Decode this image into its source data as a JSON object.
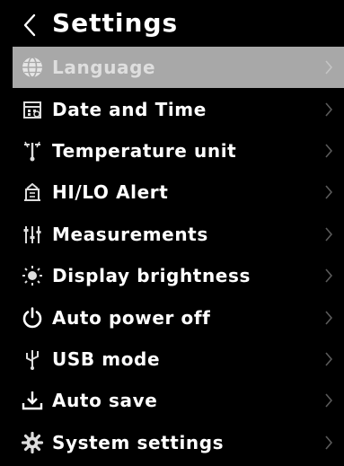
{
  "header": {
    "back_icon": "chevron-left-icon",
    "title": "Settings"
  },
  "menu": {
    "items": [
      {
        "label": "Language",
        "icon": "globe-icon",
        "selected": true
      },
      {
        "label": "Date and Time",
        "icon": "calendar-icon",
        "selected": false
      },
      {
        "label": "Temperature unit",
        "icon": "thermometer-icon",
        "selected": false
      },
      {
        "label": "HI/LO Alert",
        "icon": "alarm-icon",
        "selected": false
      },
      {
        "label": "Measurements",
        "icon": "sliders-icon",
        "selected": false
      },
      {
        "label": "Display brightness",
        "icon": "brightness-icon",
        "selected": false
      },
      {
        "label": "Auto power off",
        "icon": "power-icon",
        "selected": false
      },
      {
        "label": "USB mode",
        "icon": "usb-icon",
        "selected": false
      },
      {
        "label": "Auto save",
        "icon": "download-icon",
        "selected": false
      },
      {
        "label": "System settings",
        "icon": "gear-icon",
        "selected": false
      }
    ]
  },
  "colors": {
    "background": "#000000",
    "text": "#ffffff",
    "selected_row": "#a8a8a8",
    "chevron": "#5a5a5a"
  }
}
